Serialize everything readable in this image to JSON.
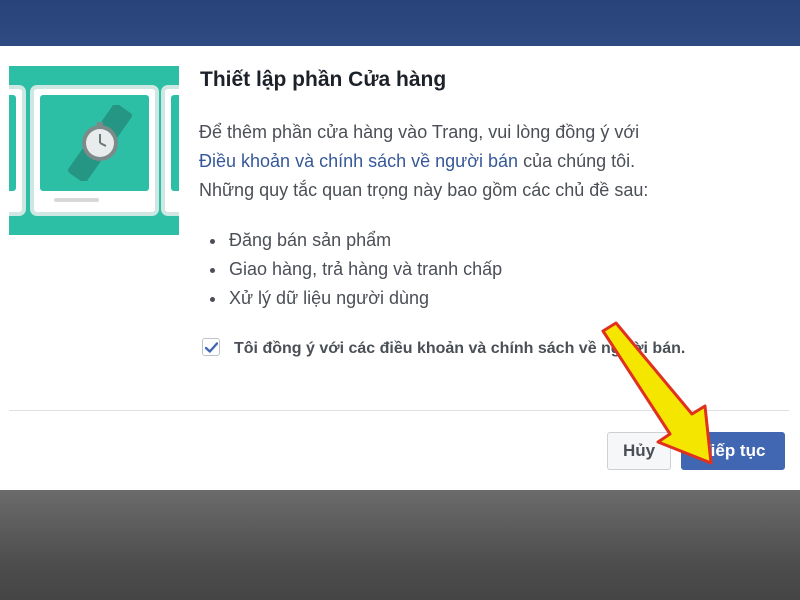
{
  "dialog": {
    "title": "Thiết lập phần Cửa hàng",
    "body_part1": "Để thêm phần cửa hàng vào Trang, vui lòng đồng ý với",
    "terms_link": "Điều khoản và chính sách về người bán",
    "body_part2": "của chúng tôi.",
    "body_part3": "Những quy tắc quan trọng này bao gồm các chủ đề sau:",
    "bullets": [
      "Đăng bán sản phẩm",
      "Giao hàng, trả hàng và tranh chấp",
      "Xử lý dữ liệu người dùng"
    ],
    "agree_checked": true,
    "agree_label": "Tôi đồng ý với các điều khoản và chính sách về người bán.",
    "cancel_label": "Hủy",
    "continue_label": "Tiếp tục"
  },
  "colors": {
    "accent": "#4267b2",
    "link": "#365899",
    "illustration": "#2dbfa6",
    "annotation_arrow": "#f5e600",
    "annotation_arrow_outline": "#e0301e"
  },
  "icons": {
    "illustration": "watch-icon",
    "checkbox": "checkmark-icon",
    "annotation": "arrow-pointer-icon"
  }
}
